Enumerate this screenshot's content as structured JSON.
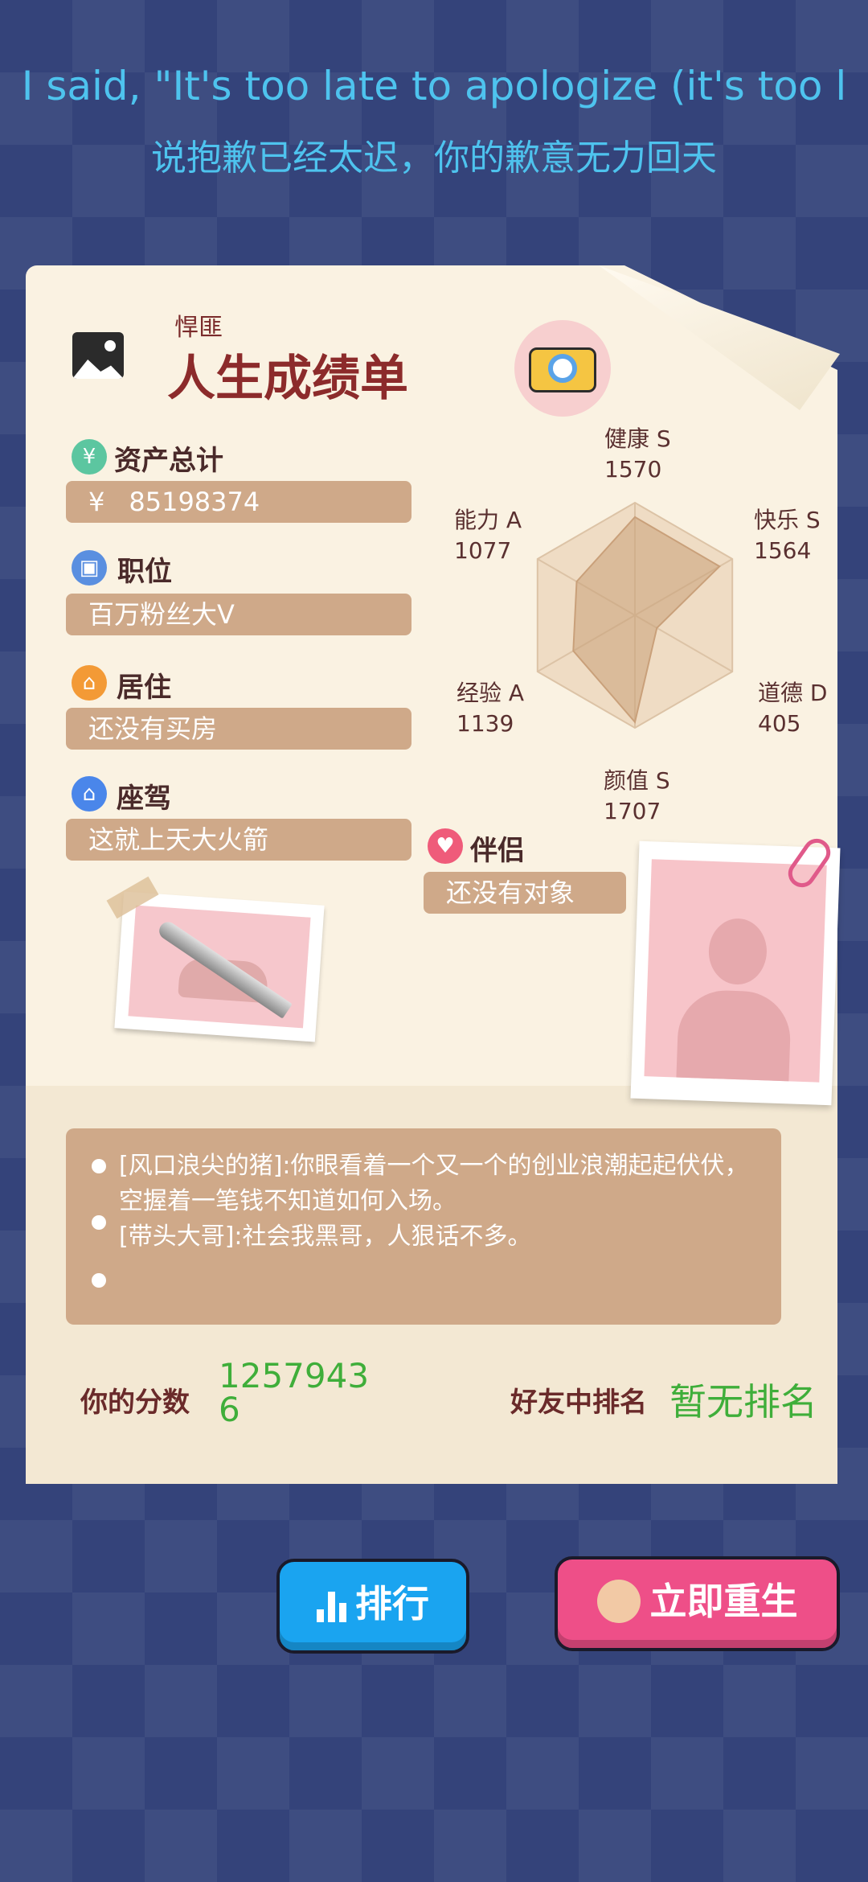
{
  "lyrics": {
    "en": "I said, \"It's too late to apologize (it's too l",
    "zh": "说抱歉已经太迟，你的歉意无力回天"
  },
  "header": {
    "subtitle": "悍匪",
    "title": "人生成绩单"
  },
  "fields": {
    "assets": {
      "label": "资产总计",
      "currency": "¥",
      "value": "85198374"
    },
    "job": {
      "label": "职位",
      "value": "百万粉丝大V"
    },
    "home": {
      "label": "居住",
      "value": "还没有买房"
    },
    "vehicle": {
      "label": "座驾",
      "value": "这就上天大火箭"
    },
    "partner": {
      "label": "伴侣",
      "value": "还没有对象"
    }
  },
  "icons": {
    "image": "image-icon",
    "camera": "camera-icon",
    "assets": "yen-icon",
    "job": "briefcase-icon",
    "home": "house-icon",
    "vehicle": "house-icon",
    "partner": "heart-icon",
    "rank": "bar-chart-icon",
    "reborn": "person-icon"
  },
  "radar": {
    "axes": [
      {
        "name": "健康",
        "grade": "S",
        "value": 1570
      },
      {
        "name": "快乐",
        "grade": "S",
        "value": 1564
      },
      {
        "name": "道德",
        "grade": "D",
        "value": 405
      },
      {
        "name": "颜值",
        "grade": "S",
        "value": 1707
      },
      {
        "name": "经验",
        "grade": "A",
        "value": 1139
      },
      {
        "name": "能力",
        "grade": "A",
        "value": 1077
      }
    ],
    "display": {
      "health": {
        "label": "健康 S",
        "value": "1570"
      },
      "happy": {
        "label": "快乐 S",
        "value": "1564"
      },
      "moral": {
        "label": "道德 D",
        "value": "405"
      },
      "looks": {
        "label": "颜值 S",
        "value": "1707"
      },
      "exp": {
        "label": "经验 A",
        "value": "1139"
      },
      "ability": {
        "label": "能力 A",
        "value": "1077"
      }
    },
    "max": 1800
  },
  "notes": {
    "text": "[风口浪尖的猪]:你眼看着一个又一个的创业浪潮起起伏伏，空握着一笔钱不知道如何入场。\n[带头大哥]:社会我黑哥，人狠话不多。"
  },
  "score": {
    "label": "你的分数",
    "value": "12579436",
    "rank_label": "好友中排名",
    "rank_value": "暂无排名"
  },
  "buttons": {
    "rank": "排行",
    "reborn": "立即重生"
  },
  "colors": {
    "background": "#34437a",
    "lyric": "#4ec3ee",
    "paper": "#faf2e2",
    "field_box": "#cfa989",
    "title": "#8c2b2b",
    "score_green": "#3fae3a",
    "rank_button": "#1aa4f0",
    "reborn_button": "#ee4f88"
  }
}
